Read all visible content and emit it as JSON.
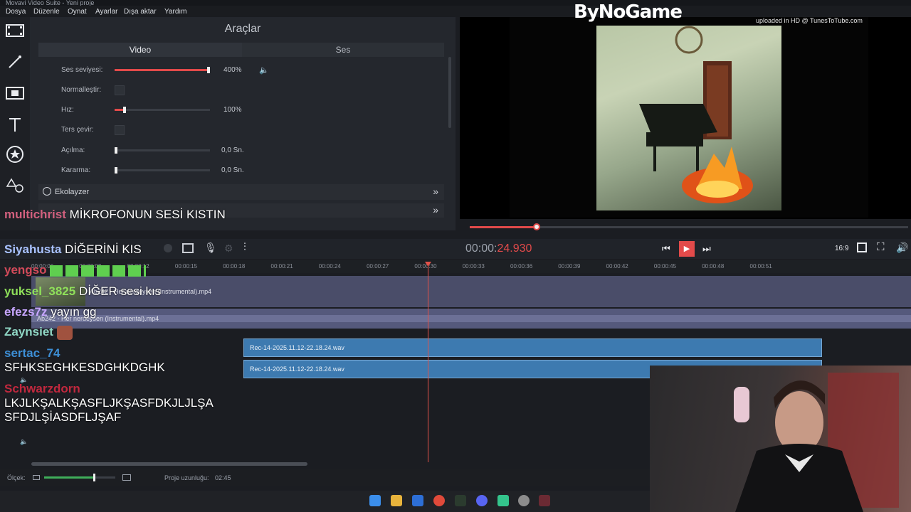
{
  "window": {
    "title": "Movavi Video Suite - Yeni proje"
  },
  "menu": [
    "Dosya",
    "Düzenle",
    "Oynat",
    "Ayarlar",
    "Dışa aktar",
    "Yardım"
  ],
  "tools_panel": {
    "title": "Araçlar",
    "tabs": [
      "Video",
      "Ses"
    ],
    "props": {
      "volume": {
        "label": "Ses seviyesi:",
        "value": "400%",
        "fraction": 1.0
      },
      "normalize": {
        "label": "Normalleştir:"
      },
      "speed": {
        "label": "Hız:",
        "value": "100%",
        "fraction": 0.1
      },
      "reverse": {
        "label": "Ters çevir:"
      },
      "fade_in": {
        "label": "Açılma:",
        "value": "0,0 Sn."
      },
      "fade_out": {
        "label": "Kararma:",
        "value": "0,0 Sn."
      }
    },
    "sections": [
      "Ekolayzer"
    ]
  },
  "preview": {
    "watermark": "ByNoGame",
    "uploaded_text": "uploaded in HD @ TunesToTube.com",
    "progress_fraction": 0.153
  },
  "controls": {
    "timecode_main": "00:00:",
    "timecode_frac": "24.930",
    "aspect": "16:9"
  },
  "timeline": {
    "ticks": [
      "00:00:06",
      "00:00:09",
      "00:00:12",
      "00:00:15",
      "00:00:18",
      "00:00:21",
      "00:00:24",
      "00:00:27",
      "00:00:30",
      "00:00:33",
      "00:00:36",
      "00:00:39",
      "00:00:42",
      "00:00:45",
      "00:00:48",
      "00:00:51"
    ],
    "video_clip": "Ab242 - Her nerdeysen (Instrumental).mp4",
    "audio_clip": "Ab242 - Her nerdeysen (Instrumental).mp4",
    "rec_clips": [
      "Rec-14-2025.11.12-22.18.24.wav",
      "Rec-14-2025.11.12-22.18.24.wav"
    ]
  },
  "status": {
    "scale_label": "Ölçek:",
    "length_label": "Proje uzunluğu:",
    "length_value": "02:45"
  },
  "chat": [
    {
      "user": "multichrist",
      "msg": "MİKROFONUN SESİ KISTIN",
      "color": "#d2607e"
    },
    {
      "user": "Siyahusta",
      "msg": "DİĞERİNİ KIS",
      "color": "#a9c2ff"
    },
    {
      "user": "yengso",
      "msg": "",
      "color": "#d34a5a"
    },
    {
      "user": "yuksel_3825",
      "msg": "DİĞER sesi kıs",
      "color": "#8fe05a"
    },
    {
      "user": "efezs7z",
      "msg": "yayın gg",
      "color": "#c7a6ff"
    },
    {
      "user": "Zaynsiet",
      "msg": "",
      "color": "#8fd6c4"
    },
    {
      "user": "sertac_74",
      "msg": "SFHKSEGHKESDGHKDGHK",
      "color": "#3d8fd6"
    },
    {
      "user": "Schwarzdorn",
      "msg": "LKJLKŞALKŞASFLJKŞASFDKJLJLŞA SFDJLŞİASDFLJŞAF",
      "color": "#c2283e"
    }
  ],
  "colors": {
    "accent": "#e24a4a",
    "clip_blue": "#3d7ab0",
    "track_video": "#4a4d69"
  }
}
